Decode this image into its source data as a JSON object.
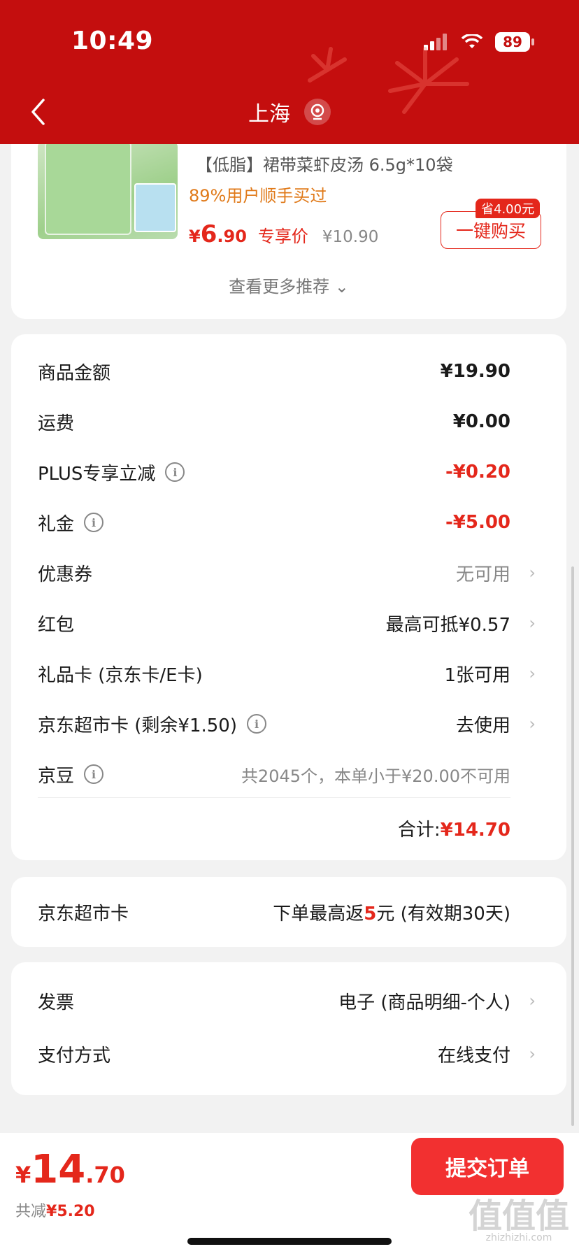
{
  "status_bar": {
    "time": "10:49",
    "battery": "89"
  },
  "header": {
    "location": "上海"
  },
  "recommendation": {
    "title": "【低脂】裙带菜虾皮汤 6.5g*10袋",
    "social_proof": "89%用户顺手买过",
    "price_symbol": "¥",
    "price_int": "6",
    "price_dec": ".90",
    "price_tag": "专享价",
    "original_price": "¥10.90",
    "save_badge": "省4.00元",
    "buy_label": "一键购买",
    "more_label": "查看更多推荐 ⌄"
  },
  "summary": {
    "rows": [
      {
        "label": "商品金额",
        "value": "¥19.90"
      },
      {
        "label": "运费",
        "value": "¥0.00"
      },
      {
        "label": "PLUS专享立减",
        "value": "-¥0.20"
      },
      {
        "label": "礼金",
        "value": "-¥5.00"
      },
      {
        "label": "优惠券",
        "value": "无可用"
      },
      {
        "label": "红包",
        "value": "最高可抵¥0.57"
      },
      {
        "label": "礼品卡 (京东卡/E卡)",
        "value": "1张可用"
      },
      {
        "label": "京东超市卡 (剩余¥1.50)",
        "value": "去使用"
      },
      {
        "label": "京豆",
        "value": "共2045个，本单小于¥20.00不可用"
      }
    ],
    "total_label": "合计:",
    "total_amount": "¥14.70"
  },
  "supermarket_card": {
    "label": "京东超市卡",
    "value_prefix": "下单最高返",
    "value_highlight": "5",
    "value_suffix": "元 (有效期30天)"
  },
  "invoice": {
    "label": "发票",
    "value": "电子 (商品明细-个人)"
  },
  "payment": {
    "label": "支付方式",
    "value": "在线支付"
  },
  "bottom": {
    "price_symbol": "¥",
    "price_int": "14",
    "price_dec": ".70",
    "saved_label": "共减",
    "saved_amount": "¥5.20",
    "submit_label": "提交订单"
  },
  "watermark": {
    "main": "值值值",
    "sub": "zhizhizhi.com"
  },
  "colors": {
    "header": "#c40e0e",
    "accent": "#e4271b",
    "submit": "#f23030"
  }
}
